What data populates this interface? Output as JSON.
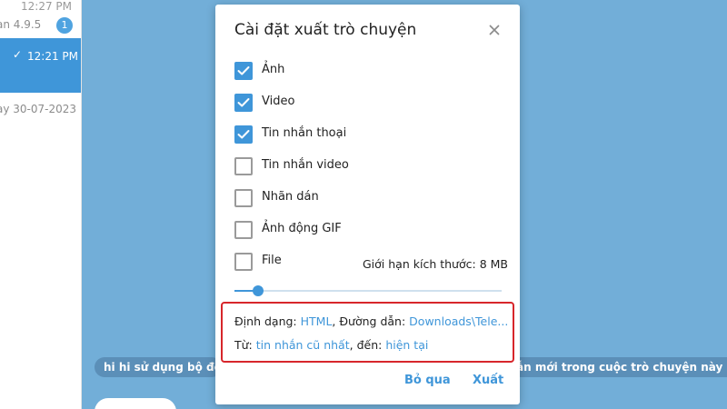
{
  "sidebar": {
    "time_top": "12:27 PM",
    "preview": "an 4.9.5",
    "badge": "1",
    "active_time": "12:21 PM",
    "date_preview": "ay 30-07-2023"
  },
  "chat": {
    "bubble_left": "hi hi sử dụng bộ đếm",
    "bubble_right": "ắn mới trong cuộc trò chuyện này sẽ tự đ"
  },
  "dialog": {
    "title": "Cài đặt xuất trò chuyện",
    "options": [
      {
        "label": "Ảnh",
        "checked": true
      },
      {
        "label": "Video",
        "checked": true
      },
      {
        "label": "Tin nhắn thoại",
        "checked": true
      },
      {
        "label": "Tin nhắn video",
        "checked": false
      },
      {
        "label": "Nhãn dán",
        "checked": false
      },
      {
        "label": "Ảnh động GIF",
        "checked": false
      },
      {
        "label": "File",
        "checked": false
      }
    ],
    "size_limit_label": "Giới hạn kích thước:",
    "size_limit_value": "8 MB",
    "slider_fraction": 0.09,
    "format": {
      "label": "Định dạng:",
      "value": "HTML",
      "path_label": ", Đường dẫn:",
      "path_value": "Downloads\\Tele..."
    },
    "range": {
      "from_label": "Từ:",
      "from_value": "tin nhắn cũ nhất",
      "to_label": ", đến:",
      "to_value": "hiện tại"
    },
    "skip_label": "Bỏ qua",
    "export_label": "Xuất"
  },
  "colors": {
    "accent": "#3f96d9",
    "highlight_border": "#d7262b",
    "chat_background": "#72aed8"
  },
  "icons": {
    "close": "close-icon",
    "check": "check-icon"
  }
}
